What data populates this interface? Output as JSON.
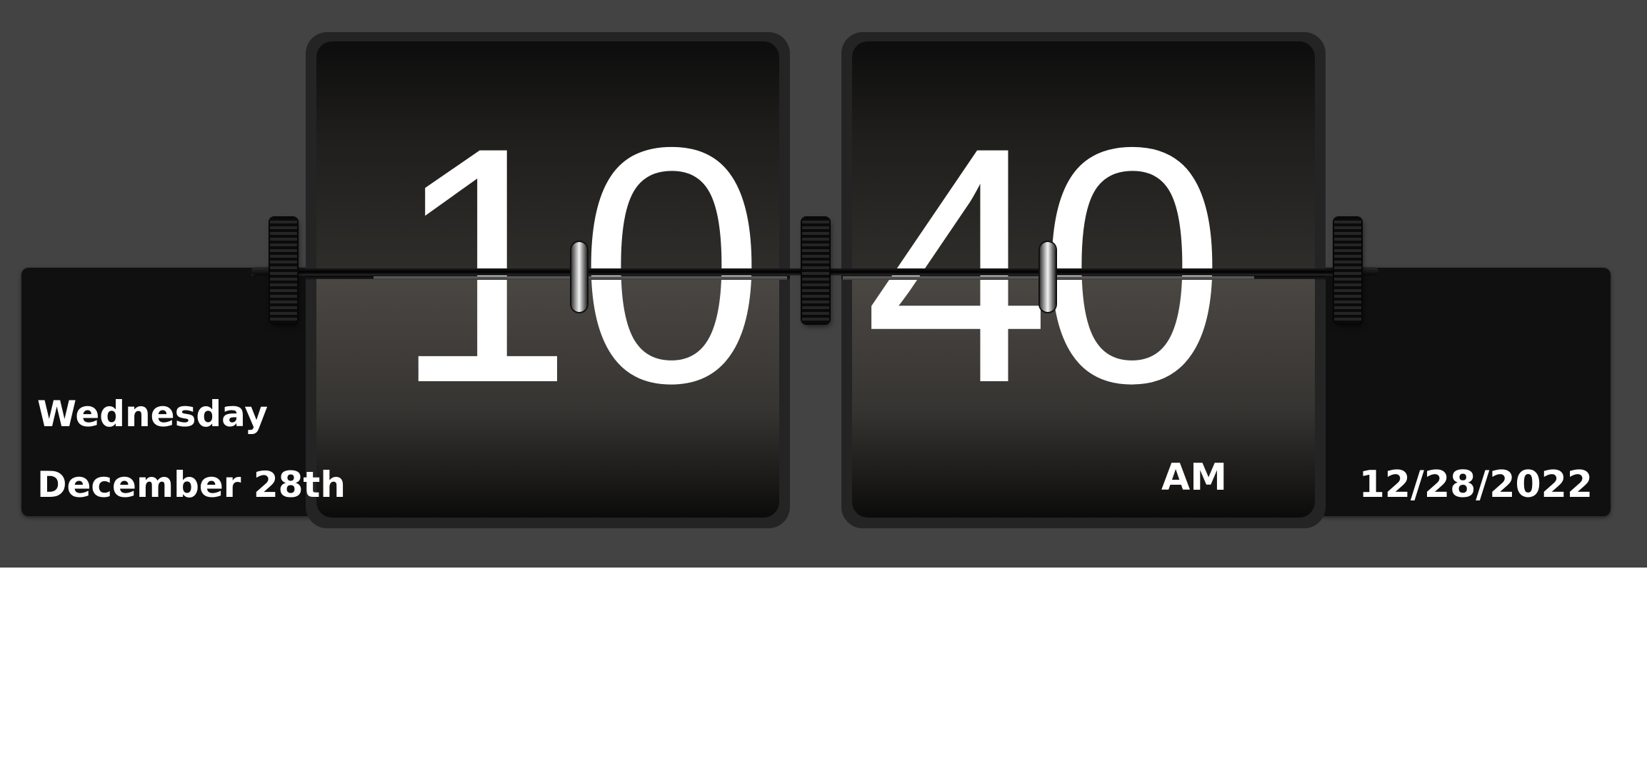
{
  "clock": {
    "hours": [
      "1",
      "0"
    ],
    "minutes": [
      "4",
      "0"
    ],
    "meridiem": "AM"
  },
  "date": {
    "weekday": "Wednesday",
    "month_day": "December 28th",
    "numeric": "12/28/2022"
  },
  "colors": {
    "background": "#434343",
    "panel": "#101010",
    "digit": "#ffffff",
    "page": "#ffffff"
  },
  "icons": {
    "hinges": [
      "hinge-icon",
      "hinge-icon",
      "hinge-icon"
    ],
    "rings": [
      "ring-icon",
      "ring-icon"
    ]
  }
}
